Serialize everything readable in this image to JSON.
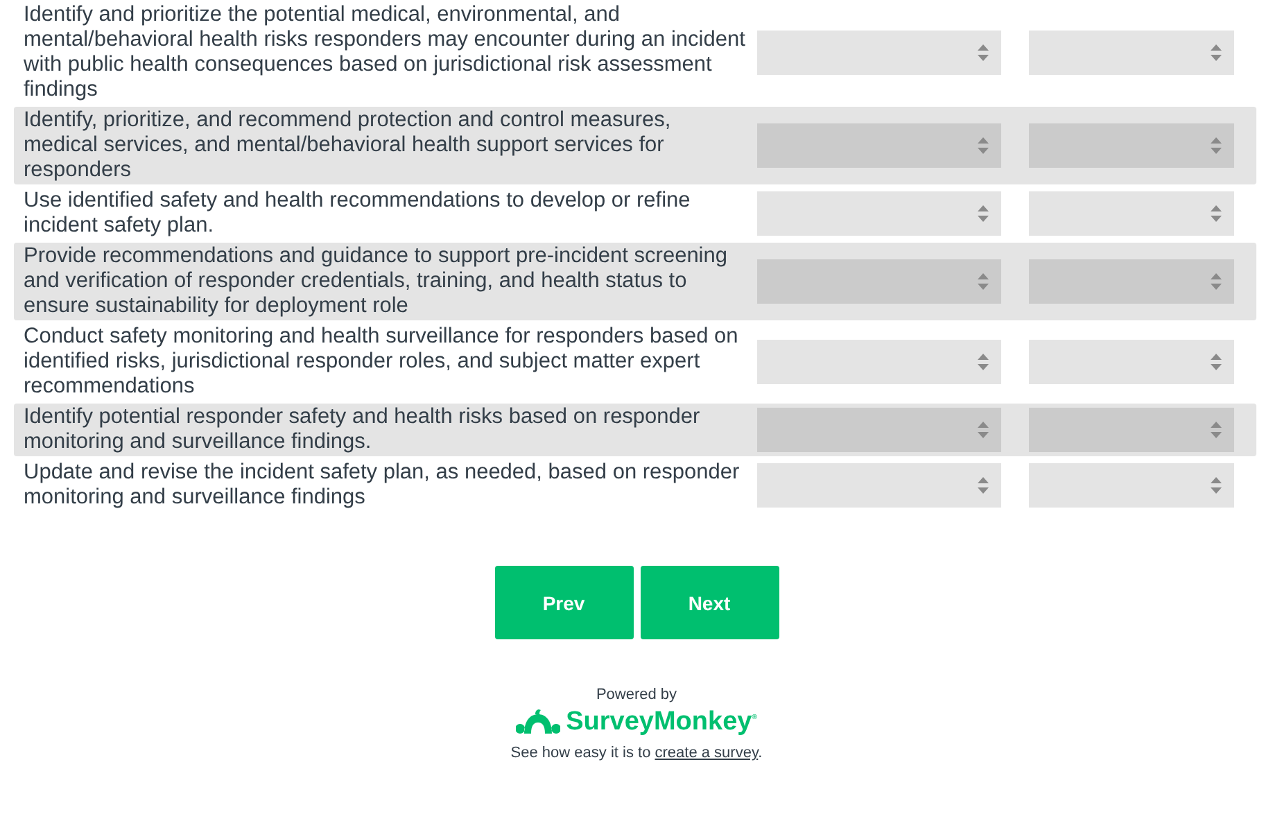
{
  "rows": [
    {
      "text": "Identify and prioritize the potential medical, environmental, and mental/behavioral health risks responders may encounter during an incident with public health consequences based on jurisdictional risk assessment findings",
      "shaded": false
    },
    {
      "text": "Identify, prioritize, and recommend protection and control measures, medical services, and mental/behavioral health support services for responders",
      "shaded": true
    },
    {
      "text": "Use identified safety and health recommendations to develop or refine incident safety plan.",
      "shaded": false
    },
    {
      "text": "Provide recommendations and guidance to support pre-incident screening and verification of responder credentials, training, and health status to ensure sustainability for deployment role",
      "shaded": true
    },
    {
      "text": "Conduct safety monitoring and health surveillance for responders based on identified risks, jurisdictional responder roles, and subject matter expert recommendations",
      "shaded": false
    },
    {
      "text": "Identify potential responder safety and health risks based on responder monitoring and surveillance findings.",
      "shaded": true
    },
    {
      "text": "Update and revise the incident safety plan, as needed, based on responder monitoring and surveillance findings",
      "shaded": false
    }
  ],
  "buttons": [
    "Prev",
    "Next"
  ],
  "footer": {
    "powered_by": "Powered by",
    "brand": "SurveyMonkey$^{®}$",
    "tagline_before": "See how easy it is to ",
    "link": "create a survey",
    "tagline_after": "."
  }
}
